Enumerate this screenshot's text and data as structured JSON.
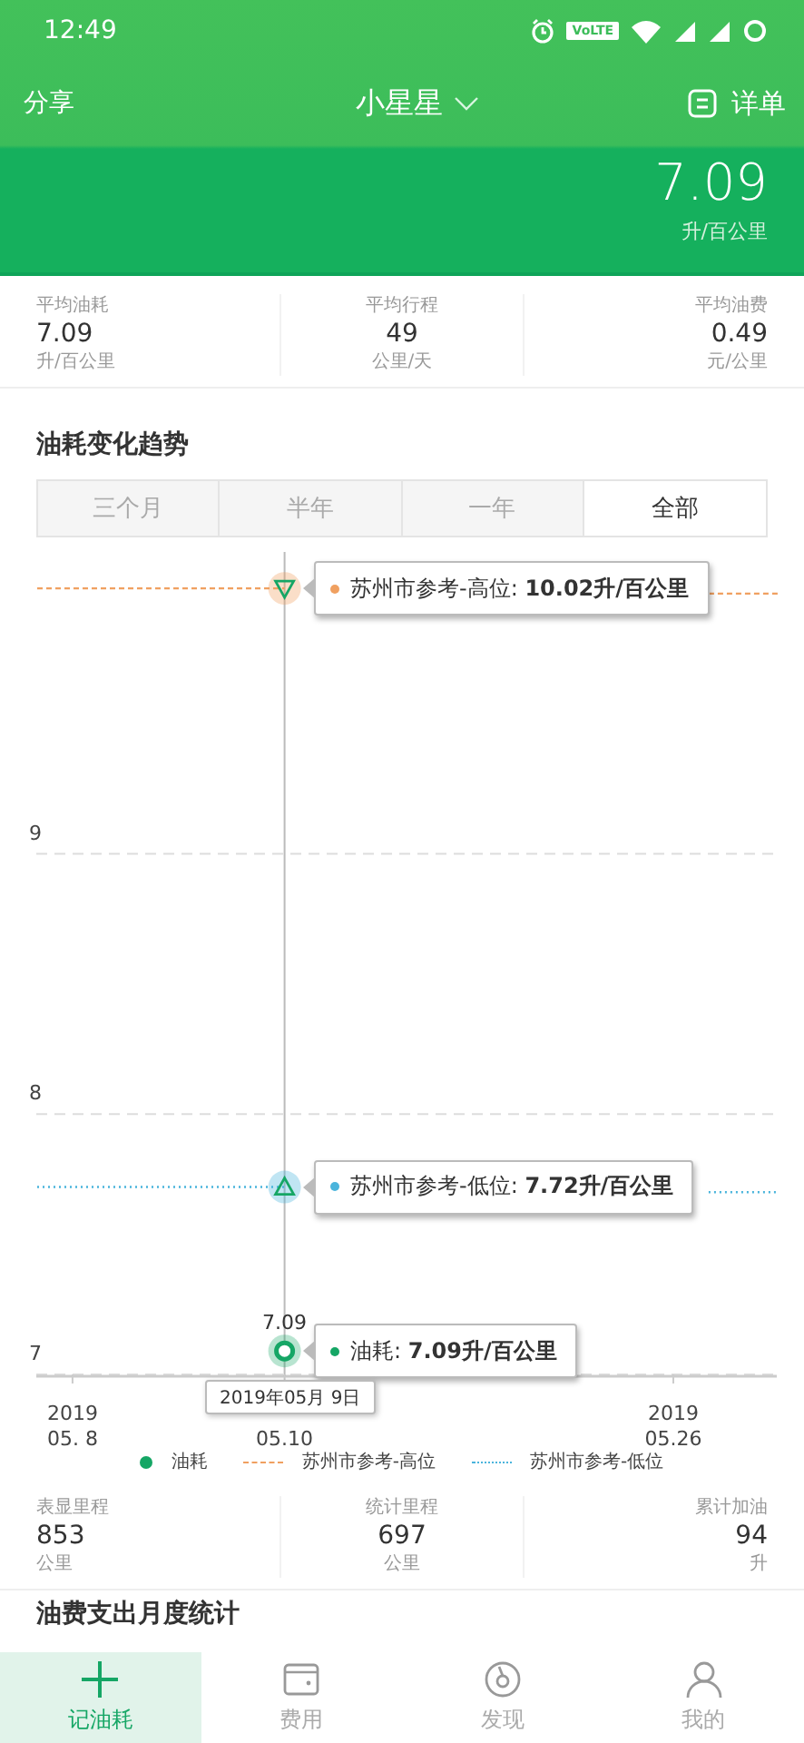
{
  "status_bar": {
    "time": "12:49",
    "badge": "VoLTE"
  },
  "header": {
    "left": "分享",
    "title": "小星星",
    "right": "详单"
  },
  "hero": {
    "value": "7.09",
    "unit": "升/百公里"
  },
  "summary": [
    {
      "label": "平均油耗",
      "value": "7.09",
      "unit": "升/百公里"
    },
    {
      "label": "平均行程",
      "value": "49",
      "unit": "公里/天"
    },
    {
      "label": "平均油费",
      "value": "0.49",
      "unit": "元/公里"
    }
  ],
  "trend": {
    "title": "油耗变化趋势",
    "tabs": [
      {
        "label": "三个月",
        "selected": false
      },
      {
        "label": "半年",
        "selected": false
      },
      {
        "label": "一年",
        "selected": false
      },
      {
        "label": "全部",
        "selected": true
      }
    ],
    "chart_data": {
      "type": "line",
      "categories": [
        null,
        "2019\n05. 8",
        null,
        null,
        null,
        null,
        null,
        "05.10",
        null,
        null,
        null,
        null,
        null,
        null,
        null,
        null,
        null,
        null,
        "2019\n05.26",
        null,
        null,
        null
      ],
      "ylim": [
        7,
        10.16
      ],
      "yticks": [
        7,
        8,
        9
      ],
      "series": [
        {
          "name": "油耗",
          "color": "#15a665",
          "marker": "circle",
          "values": [
            null,
            null,
            null,
            null,
            null,
            null,
            null,
            7.09,
            null,
            null,
            null,
            null,
            null,
            null,
            null,
            null,
            null,
            null,
            null,
            null,
            null,
            null
          ]
        },
        {
          "name": "苏州市参考-高位",
          "color": "#f0a060",
          "line_style": "dashed",
          "values": [
            10.02,
            10.02,
            10.02,
            10.02,
            10.02,
            10.02,
            10.02,
            10.02,
            null,
            null,
            null,
            null,
            null,
            null,
            null,
            null,
            null,
            null,
            null,
            10.0,
            10.0,
            10.0
          ]
        },
        {
          "name": "苏州市参考-低位",
          "color": "#4ab4dc",
          "line_style": "dotted",
          "values": [
            7.72,
            7.72,
            7.72,
            7.72,
            7.72,
            7.72,
            7.72,
            7.72,
            null,
            null,
            null,
            null,
            null,
            null,
            null,
            null,
            null,
            null,
            null,
            7.7,
            7.7,
            7.7
          ]
        }
      ],
      "value_labels": [
        "7.09"
      ]
    },
    "tooltips": [
      {
        "kind": "high",
        "text": "苏州市参考-高位: **10.02升/百公里**"
      },
      {
        "kind": "low",
        "text": "苏州市参考-低位: **7.72升/百公里**"
      },
      {
        "kind": "fuel",
        "text": "油耗: **7.09升/百公里**"
      }
    ],
    "date_tooltip": "2019年05月 9日"
  },
  "totals": [
    {
      "label": "表显里程",
      "value": "853",
      "unit": "公里"
    },
    {
      "label": "统计里程",
      "value": "697",
      "unit": "公里"
    },
    {
      "label": "累计加油",
      "value": "94",
      "unit": "升"
    }
  ],
  "next_section": "油费支出月度统计",
  "nav": [
    {
      "label": "记油耗",
      "kind": "plus",
      "selected": true
    },
    {
      "label": "费用",
      "kind": "wallet",
      "selected": false
    },
    {
      "label": "发现",
      "kind": "compass",
      "selected": false
    },
    {
      "label": "我的",
      "kind": "person",
      "selected": false
    }
  ]
}
